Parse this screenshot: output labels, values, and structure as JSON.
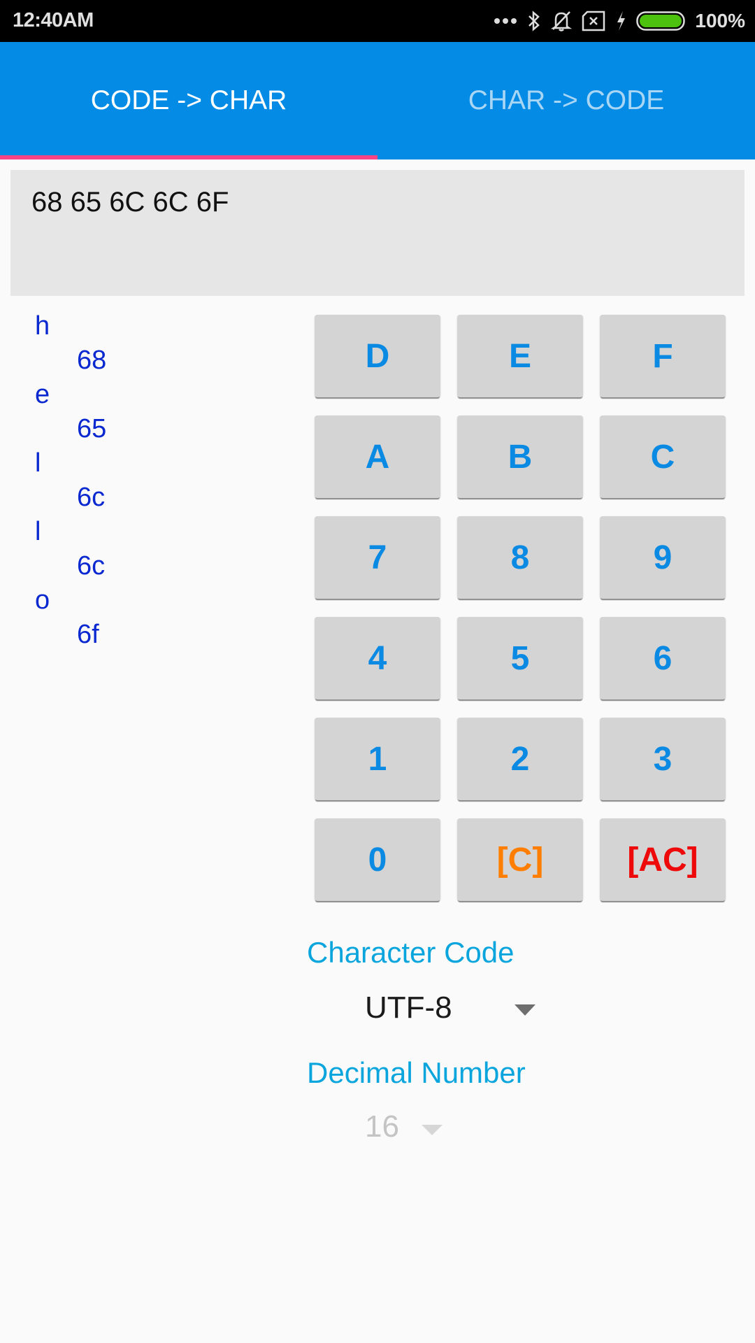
{
  "status_bar": {
    "time": "12:40AM",
    "icons": [
      "more-dots-icon",
      "bluetooth-icon",
      "notifications-off-icon",
      "no-sim-icon",
      "charging-bolt-icon",
      "battery-icon"
    ],
    "battery_percent": "100%",
    "battery_color": "#4cc20e"
  },
  "tabs": [
    {
      "label": "CODE -> CHAR",
      "active": true
    },
    {
      "label": "CHAR -> CODE",
      "active": false
    }
  ],
  "colors": {
    "app_bar": "#038be6",
    "tab_indicator": "#fb4484",
    "key_text": "#0b8ae3",
    "clear_text": "#ff7e00",
    "all_clear_text": "#ee0a0a",
    "result_text": "#0a28d0",
    "label_text": "#0aa5dd"
  },
  "input": {
    "value": "68 65 6C 6C 6F"
  },
  "results": [
    {
      "char": "h",
      "code": "68"
    },
    {
      "char": "e",
      "code": "65"
    },
    {
      "char": "l",
      "code": "6c"
    },
    {
      "char": "l",
      "code": "6c"
    },
    {
      "char": "o",
      "code": "6f"
    }
  ],
  "keypad": {
    "rows": [
      [
        "D",
        "E",
        "F"
      ],
      [
        "A",
        "B",
        "C"
      ],
      [
        "7",
        "8",
        "9"
      ],
      [
        "4",
        "5",
        "6"
      ],
      [
        "1",
        "2",
        "3"
      ],
      [
        "0",
        "[C]",
        "[AC]"
      ]
    ]
  },
  "settings": {
    "character_code_label": "Character Code",
    "character_code_value": "UTF-8",
    "decimal_number_label": "Decimal Number",
    "decimal_number_value": "16"
  }
}
